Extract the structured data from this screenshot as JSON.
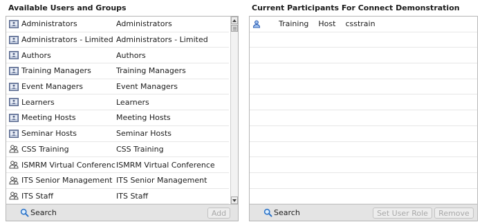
{
  "left": {
    "title": "Available Users and Groups",
    "rows": [
      {
        "name": "Administrators",
        "label": "Administrators",
        "icon": "group-icon"
      },
      {
        "name": "Administrators - Limited",
        "label": "Administrators - Limited",
        "icon": "group-icon"
      },
      {
        "name": "Authors",
        "label": "Authors",
        "icon": "group-icon"
      },
      {
        "name": "Training Managers",
        "label": "Training Managers",
        "icon": "group-icon"
      },
      {
        "name": "Event Managers",
        "label": "Event Managers",
        "icon": "group-icon"
      },
      {
        "name": "Learners",
        "label": "Learners",
        "icon": "group-icon"
      },
      {
        "name": "Meeting Hosts",
        "label": "Meeting Hosts",
        "icon": "group-icon"
      },
      {
        "name": "Seminar Hosts",
        "label": "Seminar Hosts",
        "icon": "group-icon"
      },
      {
        "name": "CSS Training",
        "label": "CSS Training",
        "icon": "users-icon"
      },
      {
        "name": "ISMRM Virtual Conference",
        "label": "ISMRM Virtual Conference",
        "icon": "users-icon"
      },
      {
        "name": "ITS Senior Management",
        "label": "ITS Senior Management",
        "icon": "users-icon"
      },
      {
        "name": "ITS Staff",
        "label": "ITS Staff",
        "icon": "users-icon"
      }
    ],
    "search_label": "Search",
    "add_label": "Add"
  },
  "right": {
    "title": "Current Participants For Connect Demonstration",
    "participants": [
      {
        "first": "Training",
        "last": "Host",
        "login": "csstrain",
        "icon": "user-icon"
      }
    ],
    "empty_rows": 11,
    "search_label": "Search",
    "set_role_label": "Set User Role",
    "remove_label": "Remove"
  },
  "colors": {
    "group_icon": "#6d7fa3",
    "user_icon": "#2f5fb3",
    "footer_bg": "#e4e4e4",
    "disabled_text": "#a8a8a8"
  }
}
